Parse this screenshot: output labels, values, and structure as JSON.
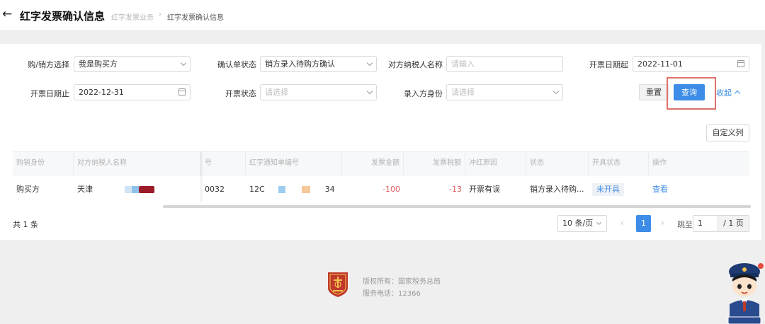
{
  "header": {
    "title": "红字发票确认信息",
    "breadcrumb": [
      "红字发票业务",
      "红字发票确认信息"
    ],
    "breadcrumb_separator": "›"
  },
  "filters": {
    "buyer_seller": {
      "label": "购/销方选择",
      "value": "我是购买方"
    },
    "confirm_status": {
      "label": "确认单状态",
      "value": "销方录入待购方确认"
    },
    "counterparty_name": {
      "label": "对方纳税人名称",
      "placeholder": "请输入"
    },
    "issue_date_start": {
      "label": "开票日期起",
      "value": "2022-11-01"
    },
    "issue_date_end": {
      "label": "开票日期止",
      "value": "2022-12-31"
    },
    "issue_status": {
      "label": "开票状态",
      "placeholder": "请选择"
    },
    "entry_identity": {
      "label": "录入方身份",
      "placeholder": "请选择"
    }
  },
  "actions": {
    "reset_label": "重置",
    "query_label": "查询",
    "collapse_label": "收起",
    "custom_columns_label": "自定义列"
  },
  "table": {
    "columns": [
      "购销身份",
      "对方纳税人名称",
      "号",
      "红字通知单编号",
      "发票金额",
      "发票税额",
      "冲红原因",
      "状态",
      "开具状态",
      "操作"
    ],
    "rows": [
      {
        "identity": "购买方",
        "counterparty": "天津",
        "tail_no": "0032",
        "notice_no_head": "12C",
        "notice_no_tail": "34",
        "amount": "-100",
        "tax": "-13",
        "reason": "开票有误",
        "status": "销方录入待购...",
        "issue_status": "未开具",
        "action": "查看"
      }
    ]
  },
  "pagination": {
    "total_text": "共 1 条",
    "page_size": "10 条/页",
    "prev": "‹",
    "current_page": "1",
    "next": "›",
    "jump_label": "跳至",
    "jump_value": "1",
    "total_pages": "/ 1 页"
  },
  "footer": {
    "copyright": "版权所有：国家税务总局",
    "phone": "服务电话：12366"
  },
  "colors": {
    "primary": "#3d8de8",
    "negative": "#e05c5c",
    "highlight_border": "#e0726a",
    "emblem_red": "#c0392b"
  }
}
